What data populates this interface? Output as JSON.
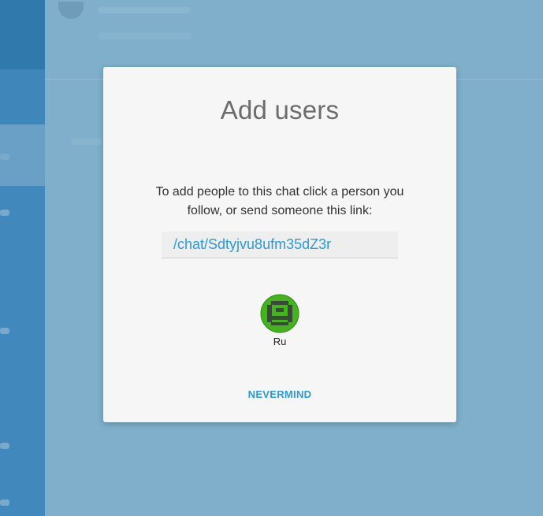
{
  "modal": {
    "title": "Add users",
    "description": "To add people to this chat click a person you follow, or send someone this link:",
    "link_value": "/chat/Sdtyjvu8ufm35dZ3r",
    "users": [
      {
        "name": "Ru",
        "avatar_icon": "green-pixel-avatar-icon"
      }
    ],
    "cancel_label": "NEVERMIND"
  },
  "colors": {
    "accent": "#2b9ad8",
    "overlay": "#7fafca",
    "avatar_green": "#44b31d"
  }
}
